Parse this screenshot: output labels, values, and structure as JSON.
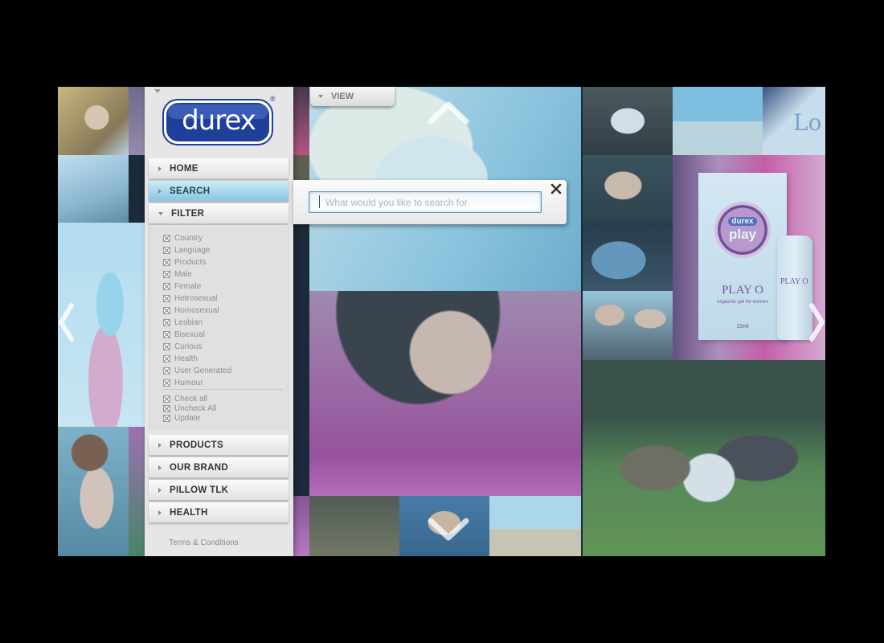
{
  "brand": {
    "logo_text": "durex",
    "registered": "®"
  },
  "sidebar": {
    "nav_top": [
      {
        "label": "HOME",
        "state": "collapsed"
      },
      {
        "label": "SEARCH",
        "state": "active"
      },
      {
        "label": "FILTER",
        "state": "expanded"
      }
    ],
    "filter_options": [
      "Country",
      "Language",
      "Products",
      "Male",
      "Female",
      "Hetrosexual",
      "Homosexual",
      "Lesbian",
      "Bisexual",
      "Curious",
      "Health",
      "User Generated",
      "Humour"
    ],
    "filter_actions": [
      "Check all",
      "Uncheck All",
      "Update"
    ],
    "nav_bottom": [
      {
        "label": "PRODUCTS"
      },
      {
        "label": "OUR BRAND"
      },
      {
        "label": "PILLOW TLK"
      },
      {
        "label": "HEALTH"
      }
    ],
    "terms": "Terms & Conditions"
  },
  "view_tab": {
    "label": "VIEW"
  },
  "search": {
    "placeholder": "What would you like to search for",
    "value": ""
  },
  "product_box": {
    "brand": "durex",
    "name": "play",
    "product": "PLAY O",
    "tagline": "orgasmic gel for women",
    "size": "15ml",
    "bottle_label": "PLAY O"
  },
  "misc_tile": {
    "text": "Lo"
  },
  "colors": {
    "brand_blue": "#1f3f9b",
    "active_nav": "#86c6e3",
    "background": "#000000"
  },
  "icons": [
    "chevron-up-icon",
    "chevron-down-icon",
    "chevron-left-icon",
    "chevron-right-icon",
    "close-icon"
  ]
}
